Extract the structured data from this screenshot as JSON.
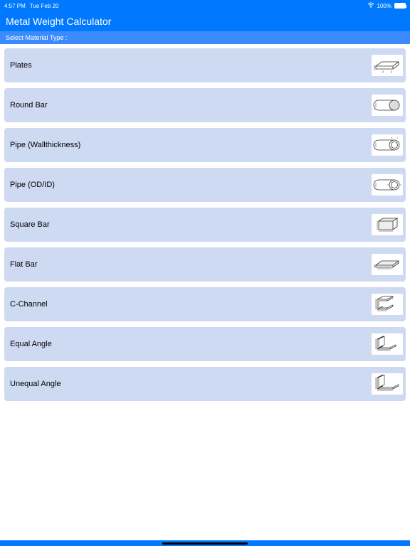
{
  "status": {
    "time": "4:57 PM",
    "date": "Tue Feb 20",
    "battery": "100%"
  },
  "header": {
    "title": "Metal Weight Calculator"
  },
  "subheader": {
    "label": "Select Material Type :"
  },
  "items": [
    {
      "label": "Plates",
      "icon": "plate-icon"
    },
    {
      "label": "Round Bar",
      "icon": "round-bar-icon"
    },
    {
      "label": "Pipe (Wallthickness)",
      "icon": "pipe-wall-icon"
    },
    {
      "label": "Pipe (OD/ID)",
      "icon": "pipe-odid-icon"
    },
    {
      "label": "Square Bar",
      "icon": "square-bar-icon"
    },
    {
      "label": "Flat Bar",
      "icon": "flat-bar-icon"
    },
    {
      "label": "C-Channel",
      "icon": "c-channel-icon"
    },
    {
      "label": "Equal Angle",
      "icon": "equal-angle-icon"
    },
    {
      "label": "Unequal Angle",
      "icon": "unequal-angle-icon"
    }
  ]
}
